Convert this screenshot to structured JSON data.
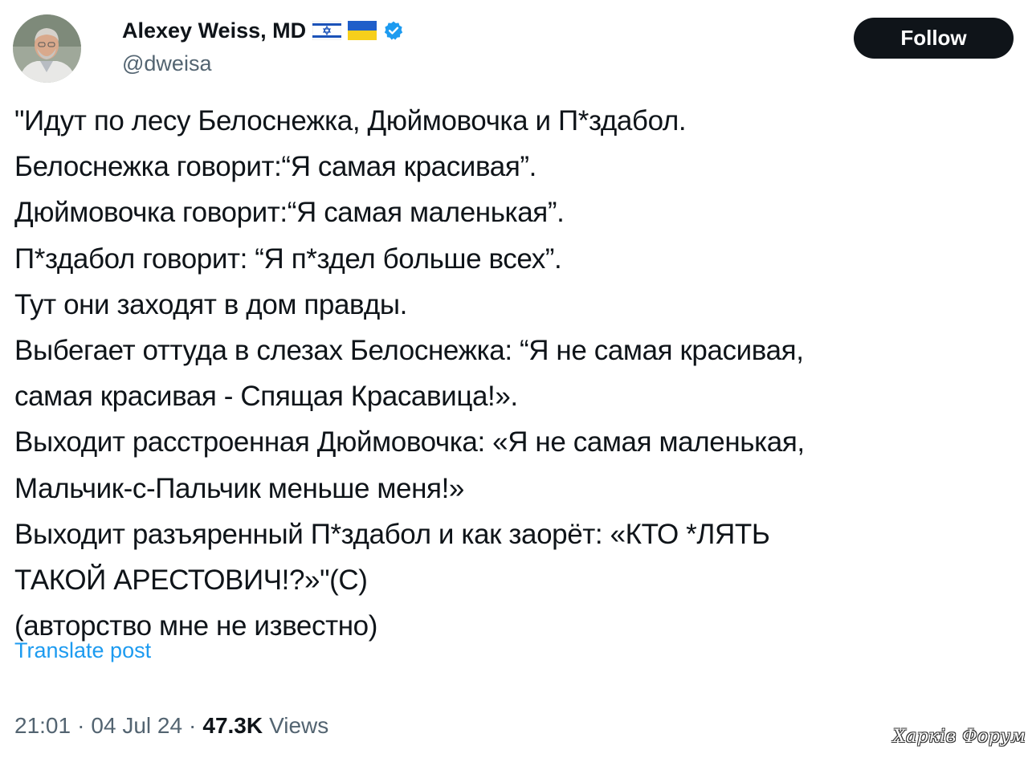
{
  "author": {
    "display_name": "Alexey Weiss, MD",
    "handle": "@dweisa",
    "flags": [
      "israel-flag-icon",
      "ukraine-flag-icon"
    ],
    "verified_icon": "verified-badge-icon",
    "verified_color": "#1d9bf0"
  },
  "actions": {
    "follow_label": "Follow"
  },
  "post": {
    "lines": [
      "\"Идут по лесу Белоснежка, Дюймовочка и П*здабол.",
      "Белоснежка говорит:“Я самая красивая”.",
      "Дюймовочка говорит:“Я самая маленькая”.",
      "П*здабол говорит: “Я п*здел больше всех”.",
      "Тут они заходят в дом правды.",
      "Выбегает оттуда в слезах Белоснежка: “Я не самая красивая,",
      "самая красивая - Спящая Красавица!».",
      "Выходит расстроенная Дюймовочка: «Я не самая маленькая,",
      "Мальчик-с-Пальчик меньше меня!»",
      "Выходит разъяренный П*здабол и как заорёт: «КТО *ЛЯТЬ",
      "ТАКОЙ АРЕСТОВИЧ!?»\"(С)",
      "(авторство мне не известно)"
    ]
  },
  "translate_label": "Translate post",
  "meta": {
    "time": "21:01",
    "date": "04 Jul 24",
    "separator": "·",
    "views_count": "47.3K",
    "views_label": "Views"
  },
  "watermark": "Харків Форум",
  "colors": {
    "text": "#0f1419",
    "secondary": "#536471",
    "link": "#1d9bf0",
    "button_bg": "#0f1419"
  }
}
